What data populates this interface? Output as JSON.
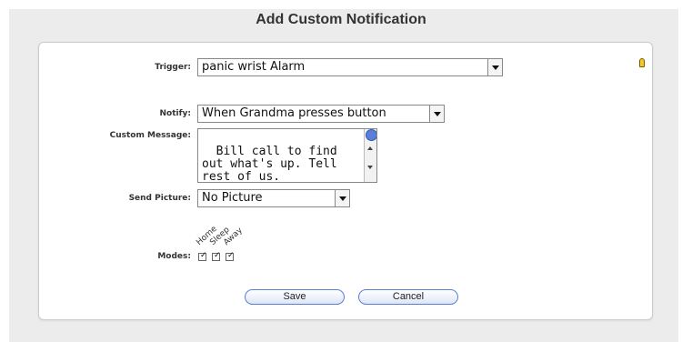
{
  "dialog": {
    "title": "Add Custom Notification"
  },
  "form": {
    "trigger": {
      "label": "Trigger:",
      "value": "panic wrist Alarm"
    },
    "notify": {
      "label": "Notify:",
      "value": "When Grandma presses button"
    },
    "custom_message": {
      "label": "Custom Message:",
      "value": "Bill call to find\nout what's up. Tell\nrest of us."
    },
    "send_picture": {
      "label": "Send Picture:",
      "value": "No Picture"
    },
    "modes": {
      "label": "Modes:",
      "items": [
        {
          "name": "Home",
          "checked": true
        },
        {
          "name": "Sleep",
          "checked": true
        },
        {
          "name": "Away",
          "checked": true
        }
      ]
    }
  },
  "buttons": {
    "save": "Save",
    "cancel": "Cancel"
  },
  "icons": {
    "help": "lightbulb-help-icon"
  },
  "colors": {
    "accent": "#5b7fd8",
    "panel_bg": "#ececec"
  }
}
